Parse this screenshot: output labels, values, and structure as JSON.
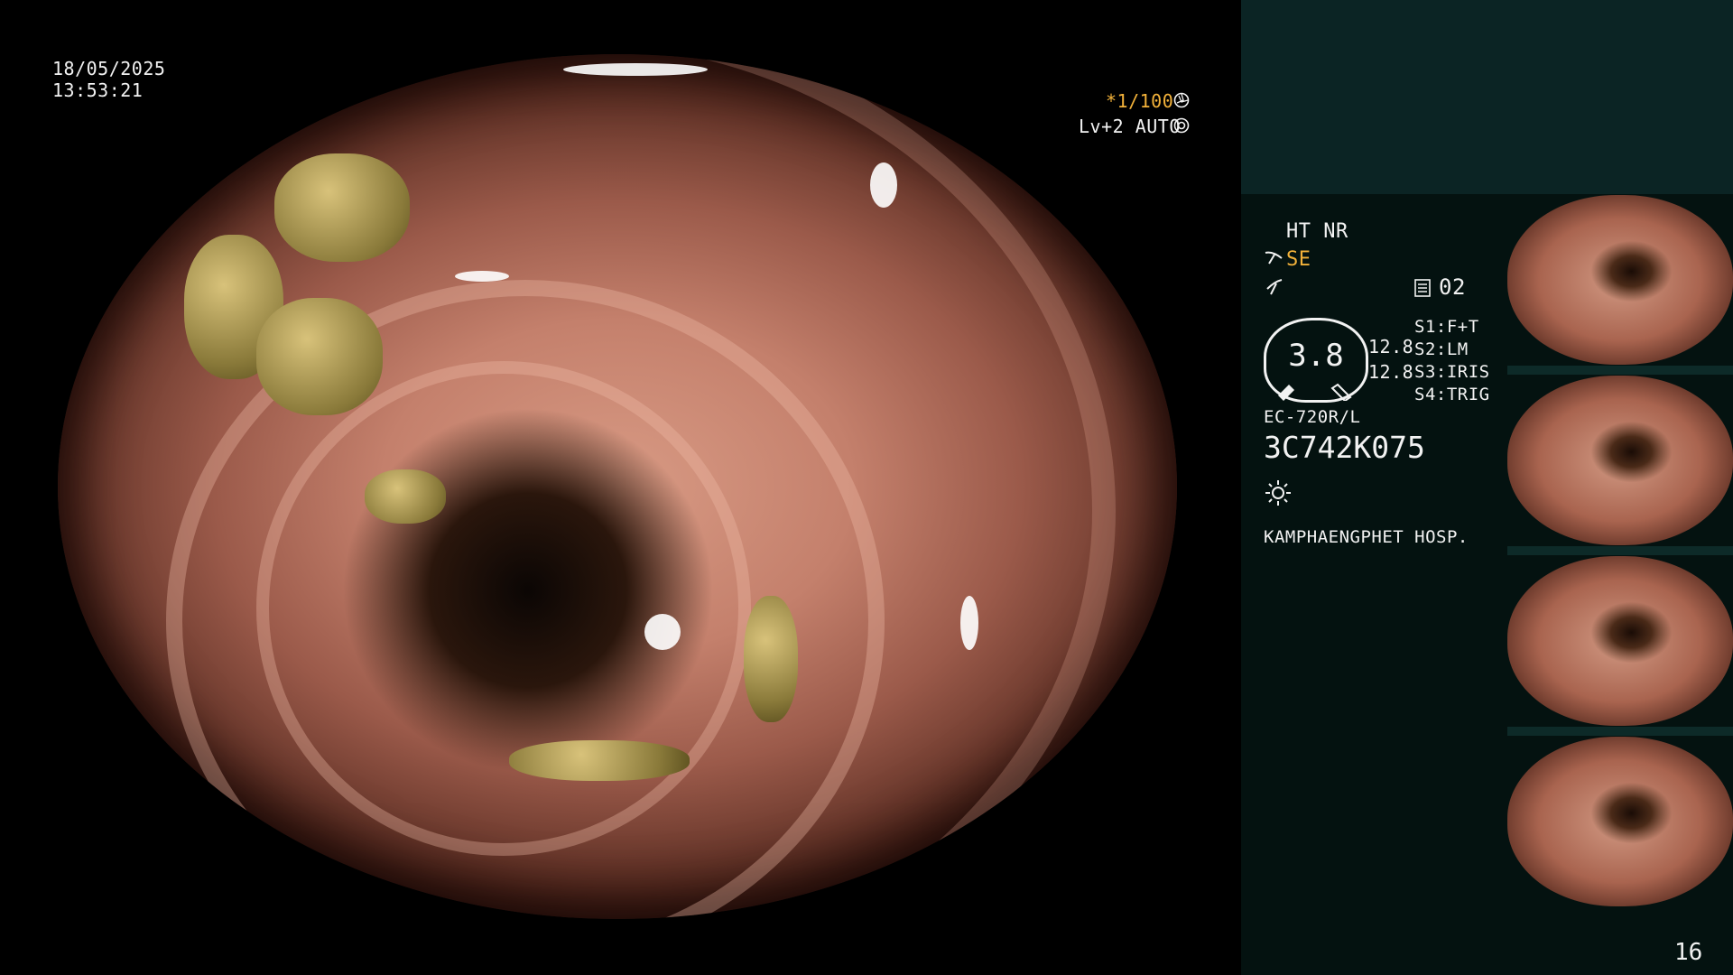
{
  "overlay": {
    "date": "18/05/2025",
    "time": "13:53:21",
    "shutter": "*1/100",
    "level": "Lv+2 AUTO"
  },
  "panel": {
    "mode": "HT NR",
    "enhance": "SE",
    "counter": "02",
    "scope_value": "3.8",
    "measure_1": "12.8",
    "measure_2": "12.8",
    "switches": [
      "S1:F+T",
      "S2:LM",
      "S3:IRIS",
      "S4:TRIG"
    ],
    "scope_model": "EC-720R/L",
    "serial": "3C742K075",
    "hospital": "KAMPHAENGPHET HOSP.",
    "page_number": "16"
  },
  "colors": {
    "enhance_accent": "#f3b23a",
    "shutter_accent": "#f3b23a",
    "panel_bg": "#041210",
    "panel_top_bg": "#0b2424"
  },
  "icons": [
    "scissors-icon",
    "flash-icon",
    "memory-icon",
    "brightness-icon",
    "shutter-icon",
    "auto-iris-icon"
  ]
}
